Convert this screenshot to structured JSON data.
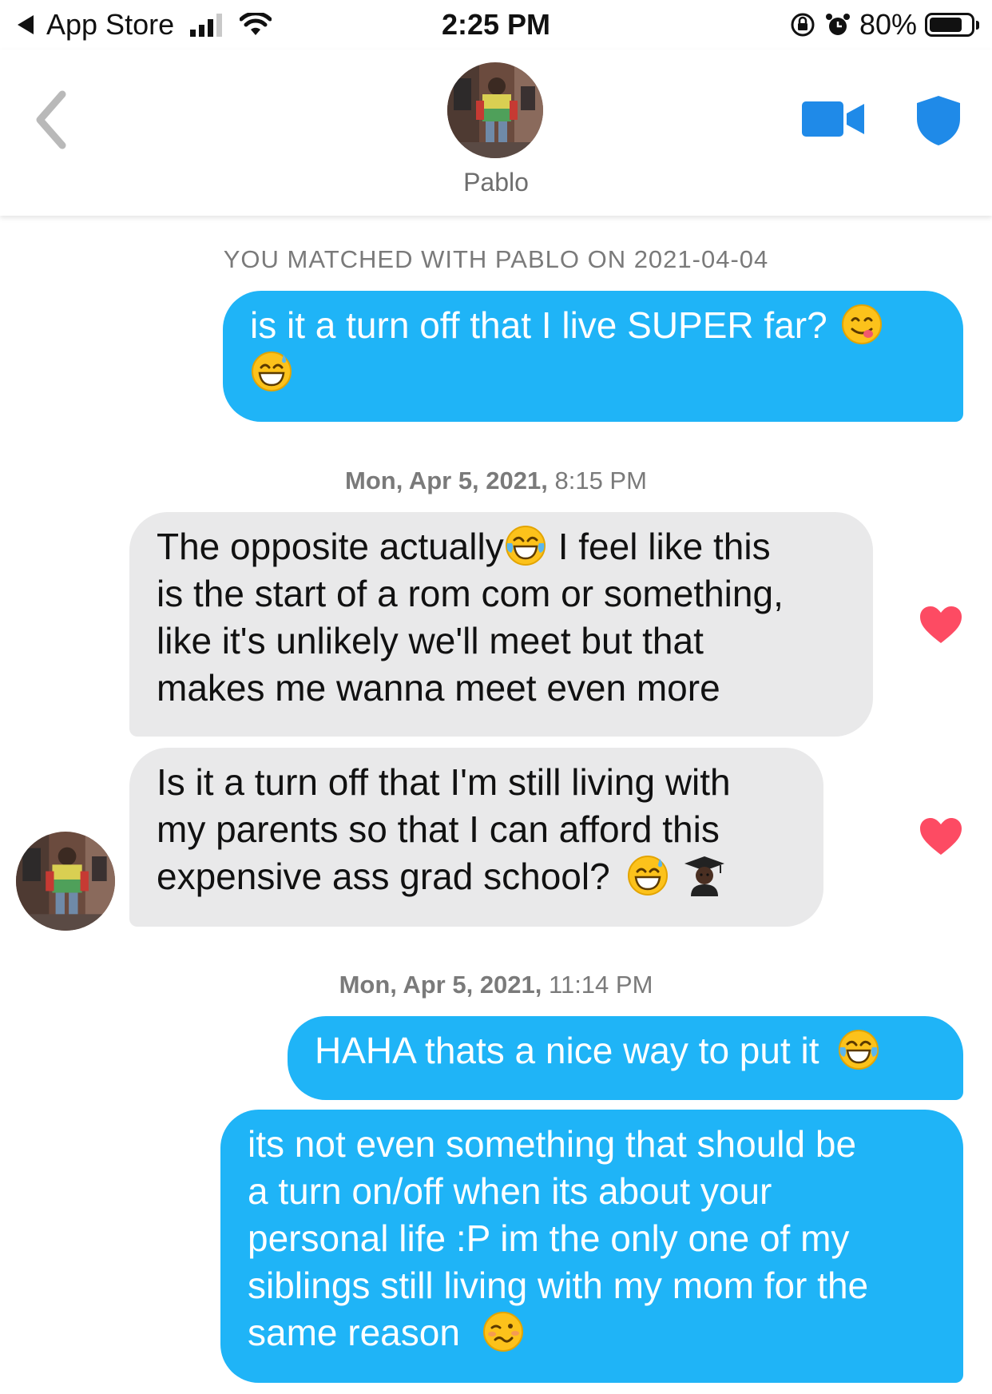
{
  "status_bar": {
    "back_app": "App Store",
    "time": "2:25 PM",
    "battery": "80%",
    "battery_level": 0.8
  },
  "header": {
    "name": "Pablo"
  },
  "chat": {
    "match_notice": "YOU MATCHED WITH PABLO ON 2021-04-04",
    "messages": [
      {
        "from": "me",
        "lines": [
          "is it a turn off that I live SUPER far?"
        ],
        "emoji": [
          "face-savoring-food",
          "grinning-face-with-sweat"
        ]
      },
      {
        "timestamp_date": "Mon, Apr 5, 2021,",
        "timestamp_time": "8:15 PM"
      },
      {
        "from": "Pablo",
        "lines": [
          "The opposite actually",
          "I feel like this",
          "is the start of a rom com or something,",
          "like it's unlikely we'll meet but that",
          "makes me wanna meet even more"
        ],
        "emoji": [
          "face-with-tears-of-joy"
        ],
        "liked": true
      },
      {
        "from": "Pablo",
        "lines": [
          "Is it a turn off that I'm still living with",
          "my parents so that I can afford this",
          "expensive ass grad school?"
        ],
        "emoji": [
          "grinning-face-with-sweat",
          "man-student"
        ],
        "liked": true
      },
      {
        "timestamp_date": "Mon, Apr 5, 2021,",
        "timestamp_time": "11:14 PM"
      },
      {
        "from": "me",
        "lines": [
          "HAHA thats a nice way to put it"
        ],
        "emoji": [
          "face-with-tears-of-joy"
        ]
      },
      {
        "from": "me",
        "lines": [
          "its not even something that should be",
          "a turn on/off when its about your",
          "personal life :P im the only one of my",
          "siblings still living with my mom for the",
          "same reason"
        ],
        "emoji": [
          "woozy-face"
        ]
      }
    ]
  },
  "colors": {
    "outgoing_bubble": "#1fb4f7",
    "incoming_bubble": "#e9e9ea",
    "accent_blue": "#1f8ae8",
    "heart": "#fd4b63"
  }
}
